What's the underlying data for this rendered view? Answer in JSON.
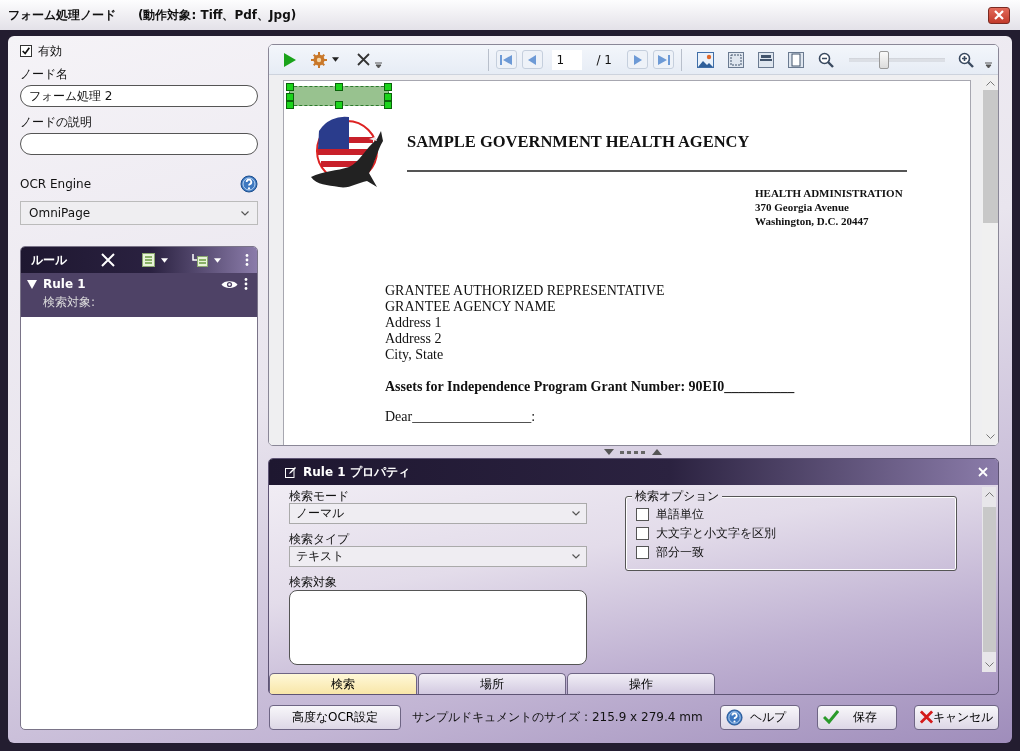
{
  "window": {
    "title": "フォーム処理ノード",
    "subtitle": "(動作対象: Tiff、Pdf、Jpg)"
  },
  "node": {
    "enabled": {
      "label": "有効",
      "checked": true
    },
    "name_label": "ノード名",
    "name_value": "フォーム処理 2",
    "desc_label": "ノードの説明",
    "ocr_label": "OCR Engine",
    "ocr_value": "OmniPage"
  },
  "rules": {
    "title": "ルール",
    "items": [
      {
        "name": "Rule 1",
        "detail": "検索対象:",
        "expanded": true,
        "selected": true
      }
    ]
  },
  "viewer": {
    "page": "1",
    "page_total": "/ 1",
    "zoom": {
      "level": 0.36
    },
    "document": {
      "heading": "SAMPLE GOVERNMENT HEALTH AGENCY",
      "address": [
        "HEALTH ADMINISTRATION",
        "370 Georgia Avenue",
        "Washington, D.C. 20447"
      ],
      "recipient": [
        "GRANTEE AUTHORIZED REPRESENTATIVE",
        "GRANTEE AGENCY NAME",
        "Address 1",
        "Address 2",
        "City, State"
      ],
      "grant_line": "Assets for Independence Program Grant Number:  90EI0__________",
      "salutation": "Dear_________________:"
    }
  },
  "properties": {
    "title": "Rule 1 プロパティ",
    "fields": [
      {
        "label": "検索モード",
        "kind": "select",
        "value": "ノーマル"
      },
      {
        "label": "検索タイプ",
        "kind": "select",
        "value": "テキスト"
      },
      {
        "label": "検索対象",
        "kind": "textarea"
      }
    ],
    "options": {
      "title": "検索オプション",
      "items": [
        {
          "label": "単語単位",
          "checked": false
        },
        {
          "label": "大文字と小文字を区別",
          "checked": false
        },
        {
          "label": "部分一致",
          "checked": false
        }
      ]
    },
    "tabs": [
      {
        "label": "検索",
        "selected": true
      },
      {
        "label": "場所",
        "selected": false
      },
      {
        "label": "操作",
        "selected": false
      }
    ]
  },
  "footer": {
    "advanced_button": "高度なOCR設定",
    "sample_size": "サンプルドキュメントのサイズ : 215.9 x 279.4 mm",
    "buttons": [
      {
        "label": "ヘルプ",
        "kind": "help"
      },
      {
        "label": "保存",
        "kind": "save"
      },
      {
        "label": "キャンセル",
        "kind": "cancel"
      }
    ]
  }
}
